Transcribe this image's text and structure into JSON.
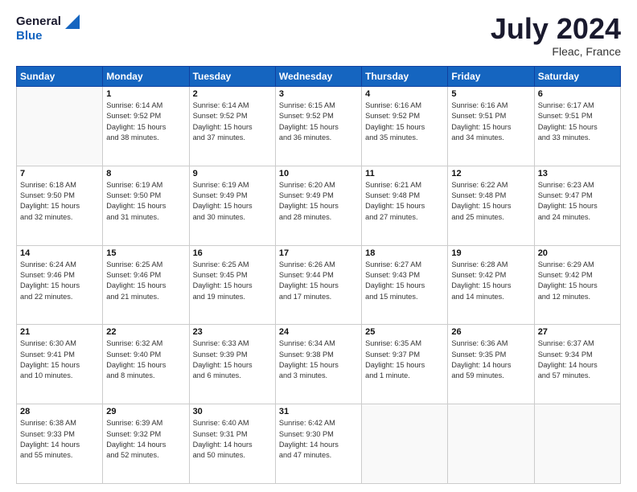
{
  "header": {
    "logo_line1": "General",
    "logo_line2": "Blue",
    "title": "July 2024",
    "location": "Fleac, France"
  },
  "days_of_week": [
    "Sunday",
    "Monday",
    "Tuesday",
    "Wednesday",
    "Thursday",
    "Friday",
    "Saturday"
  ],
  "weeks": [
    [
      {
        "day": "",
        "info": ""
      },
      {
        "day": "1",
        "info": "Sunrise: 6:14 AM\nSunset: 9:52 PM\nDaylight: 15 hours\nand 38 minutes."
      },
      {
        "day": "2",
        "info": "Sunrise: 6:14 AM\nSunset: 9:52 PM\nDaylight: 15 hours\nand 37 minutes."
      },
      {
        "day": "3",
        "info": "Sunrise: 6:15 AM\nSunset: 9:52 PM\nDaylight: 15 hours\nand 36 minutes."
      },
      {
        "day": "4",
        "info": "Sunrise: 6:16 AM\nSunset: 9:52 PM\nDaylight: 15 hours\nand 35 minutes."
      },
      {
        "day": "5",
        "info": "Sunrise: 6:16 AM\nSunset: 9:51 PM\nDaylight: 15 hours\nand 34 minutes."
      },
      {
        "day": "6",
        "info": "Sunrise: 6:17 AM\nSunset: 9:51 PM\nDaylight: 15 hours\nand 33 minutes."
      }
    ],
    [
      {
        "day": "7",
        "info": "Sunrise: 6:18 AM\nSunset: 9:50 PM\nDaylight: 15 hours\nand 32 minutes."
      },
      {
        "day": "8",
        "info": "Sunrise: 6:19 AM\nSunset: 9:50 PM\nDaylight: 15 hours\nand 31 minutes."
      },
      {
        "day": "9",
        "info": "Sunrise: 6:19 AM\nSunset: 9:49 PM\nDaylight: 15 hours\nand 30 minutes."
      },
      {
        "day": "10",
        "info": "Sunrise: 6:20 AM\nSunset: 9:49 PM\nDaylight: 15 hours\nand 28 minutes."
      },
      {
        "day": "11",
        "info": "Sunrise: 6:21 AM\nSunset: 9:48 PM\nDaylight: 15 hours\nand 27 minutes."
      },
      {
        "day": "12",
        "info": "Sunrise: 6:22 AM\nSunset: 9:48 PM\nDaylight: 15 hours\nand 25 minutes."
      },
      {
        "day": "13",
        "info": "Sunrise: 6:23 AM\nSunset: 9:47 PM\nDaylight: 15 hours\nand 24 minutes."
      }
    ],
    [
      {
        "day": "14",
        "info": "Sunrise: 6:24 AM\nSunset: 9:46 PM\nDaylight: 15 hours\nand 22 minutes."
      },
      {
        "day": "15",
        "info": "Sunrise: 6:25 AM\nSunset: 9:46 PM\nDaylight: 15 hours\nand 21 minutes."
      },
      {
        "day": "16",
        "info": "Sunrise: 6:25 AM\nSunset: 9:45 PM\nDaylight: 15 hours\nand 19 minutes."
      },
      {
        "day": "17",
        "info": "Sunrise: 6:26 AM\nSunset: 9:44 PM\nDaylight: 15 hours\nand 17 minutes."
      },
      {
        "day": "18",
        "info": "Sunrise: 6:27 AM\nSunset: 9:43 PM\nDaylight: 15 hours\nand 15 minutes."
      },
      {
        "day": "19",
        "info": "Sunrise: 6:28 AM\nSunset: 9:42 PM\nDaylight: 15 hours\nand 14 minutes."
      },
      {
        "day": "20",
        "info": "Sunrise: 6:29 AM\nSunset: 9:42 PM\nDaylight: 15 hours\nand 12 minutes."
      }
    ],
    [
      {
        "day": "21",
        "info": "Sunrise: 6:30 AM\nSunset: 9:41 PM\nDaylight: 15 hours\nand 10 minutes."
      },
      {
        "day": "22",
        "info": "Sunrise: 6:32 AM\nSunset: 9:40 PM\nDaylight: 15 hours\nand 8 minutes."
      },
      {
        "day": "23",
        "info": "Sunrise: 6:33 AM\nSunset: 9:39 PM\nDaylight: 15 hours\nand 6 minutes."
      },
      {
        "day": "24",
        "info": "Sunrise: 6:34 AM\nSunset: 9:38 PM\nDaylight: 15 hours\nand 3 minutes."
      },
      {
        "day": "25",
        "info": "Sunrise: 6:35 AM\nSunset: 9:37 PM\nDaylight: 15 hours\nand 1 minute."
      },
      {
        "day": "26",
        "info": "Sunrise: 6:36 AM\nSunset: 9:35 PM\nDaylight: 14 hours\nand 59 minutes."
      },
      {
        "day": "27",
        "info": "Sunrise: 6:37 AM\nSunset: 9:34 PM\nDaylight: 14 hours\nand 57 minutes."
      }
    ],
    [
      {
        "day": "28",
        "info": "Sunrise: 6:38 AM\nSunset: 9:33 PM\nDaylight: 14 hours\nand 55 minutes."
      },
      {
        "day": "29",
        "info": "Sunrise: 6:39 AM\nSunset: 9:32 PM\nDaylight: 14 hours\nand 52 minutes."
      },
      {
        "day": "30",
        "info": "Sunrise: 6:40 AM\nSunset: 9:31 PM\nDaylight: 14 hours\nand 50 minutes."
      },
      {
        "day": "31",
        "info": "Sunrise: 6:42 AM\nSunset: 9:30 PM\nDaylight: 14 hours\nand 47 minutes."
      },
      {
        "day": "",
        "info": ""
      },
      {
        "day": "",
        "info": ""
      },
      {
        "day": "",
        "info": ""
      }
    ]
  ]
}
